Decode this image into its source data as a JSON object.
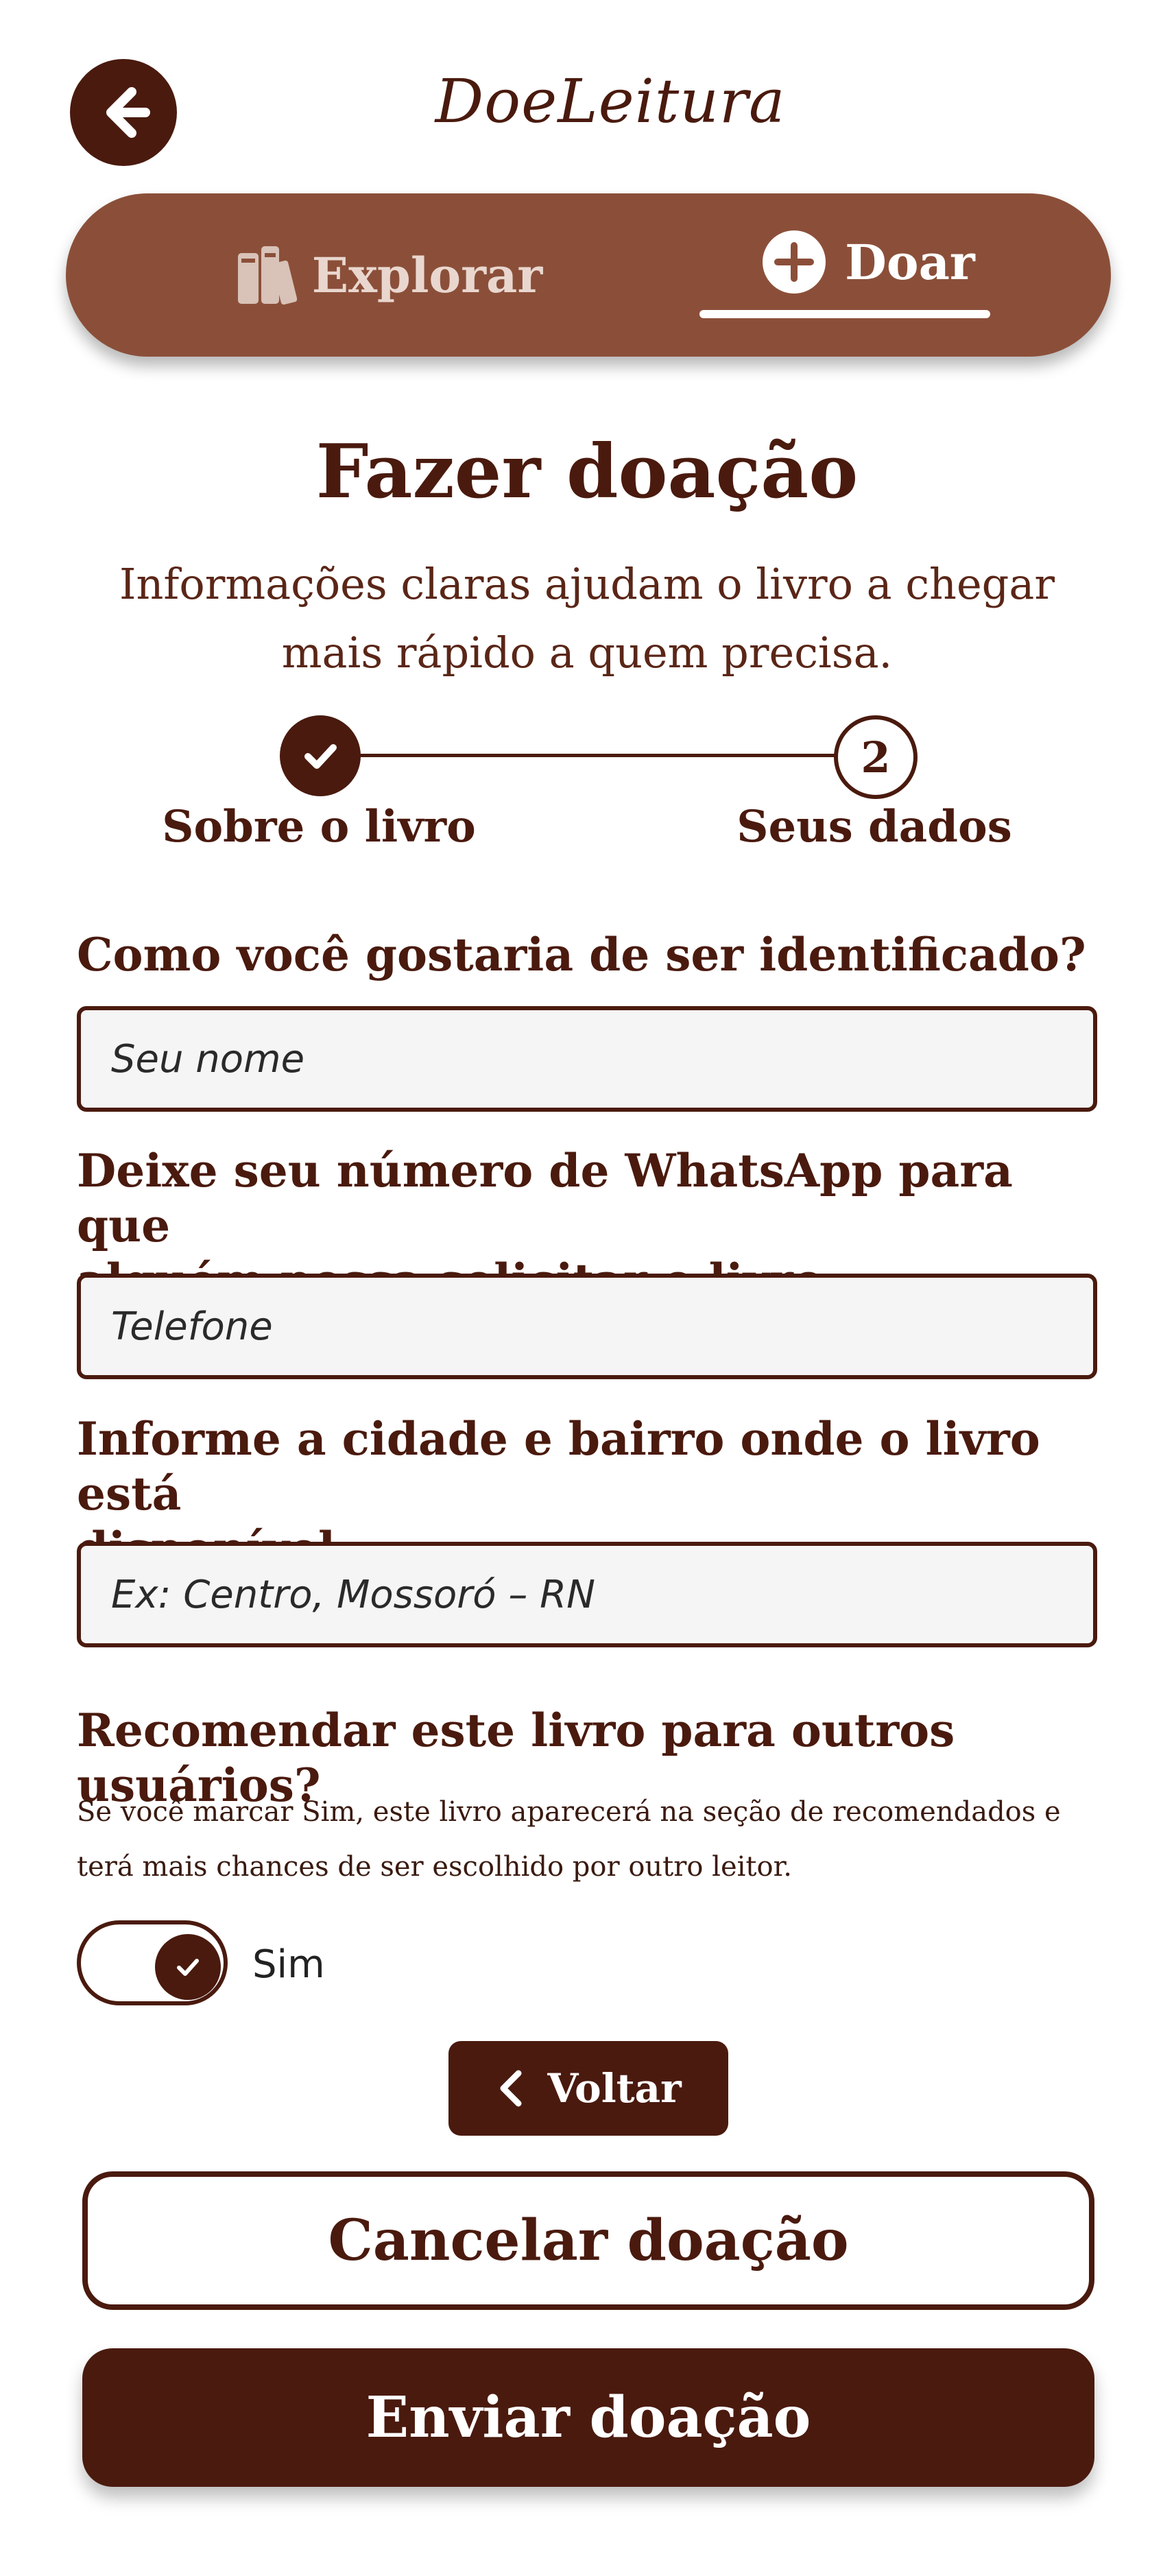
{
  "header": {
    "title": "DoeLeitura",
    "back_icon": "arrow-left-icon"
  },
  "nav": {
    "explore_label": "Explorar",
    "explore_icon": "books-icon",
    "donate_label": "Doar",
    "donate_icon": "plus-circle-icon",
    "active": "Doar"
  },
  "page": {
    "title": "Fazer doação",
    "subtitle_line1": "Informações claras ajudam o livro a chegar",
    "subtitle_line2": "mais rápido a quem precisa."
  },
  "stepper": {
    "step1_label": "Sobre o livro",
    "step1_status": "done",
    "step2_number": "2",
    "step2_label": "Seus dados"
  },
  "form": {
    "name_label": "Como você gostaria de ser identificado?",
    "name_placeholder": "Seu nome",
    "phone_label_line1": "Deixe seu número de WhatsApp para que",
    "phone_label_line2": "alguém possa solicitar o livro",
    "phone_placeholder": "Telefone",
    "location_label_line1": "Informe a cidade e bairro onde o livro está",
    "location_label_line2": "disponível",
    "location_placeholder": "Ex: Centro, Mossoró – RN",
    "recommend_label": "Recomendar este livro para outros usuários?",
    "recommend_note": "Se você marcar Sim, este livro aparecerá na seção de recomendados e terá mais chances de ser escolhido por outro leitor.",
    "recommend_toggle_label": "Sim",
    "recommend_toggle_on": true
  },
  "buttons": {
    "back_label": "Voltar",
    "cancel_label": "Cancelar doação",
    "submit_label": "Enviar doação"
  },
  "colors": {
    "primary": "#4a1a0e",
    "nav_bg": "#8b4f39",
    "input_bg": "#f5f5f5"
  }
}
